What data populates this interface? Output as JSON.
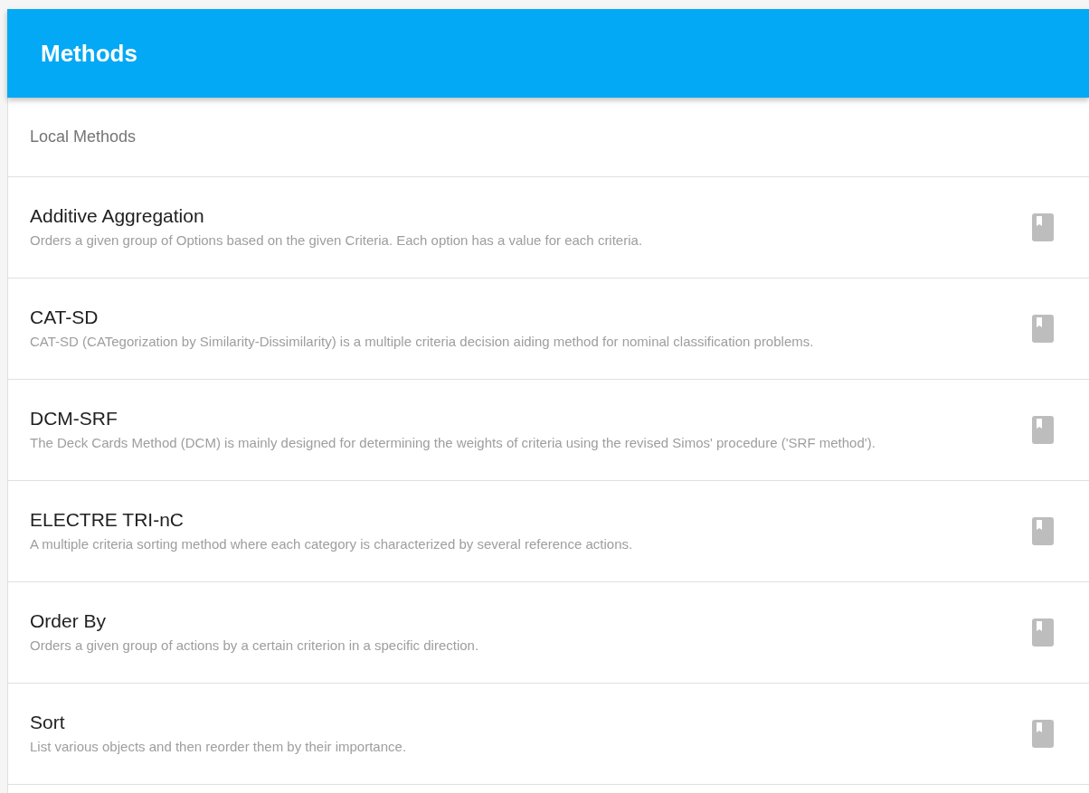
{
  "header": {
    "title": "Methods"
  },
  "section": {
    "title": "Local Methods"
  },
  "methods": [
    {
      "name": "Additive Aggregation",
      "description": "Orders a given group of Options based on the given Criteria. Each option has a value for each criteria."
    },
    {
      "name": "CAT-SD",
      "description": "CAT-SD (CATegorization by Similarity-Dissimilarity) is a multiple criteria decision aiding method for nominal classification problems."
    },
    {
      "name": "DCM-SRF",
      "description": "The Deck Cards Method (DCM) is mainly designed for determining the weights of criteria using the revised Simos' procedure ('SRF method')."
    },
    {
      "name": "ELECTRE TRI-nC",
      "description": "A multiple criteria sorting method where each category is characterized by several reference actions."
    },
    {
      "name": "Order By",
      "description": "Orders a given group of actions by a certain criterion in a specific direction."
    },
    {
      "name": "Sort",
      "description": "List various objects and then reorder them by their importance."
    }
  ]
}
